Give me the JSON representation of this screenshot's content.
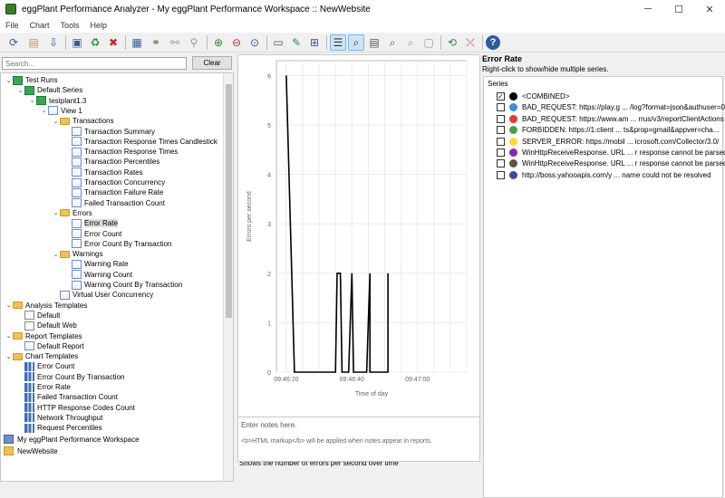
{
  "window": {
    "title": "eggPlant Performance Analyzer - My eggPlant Performance Workspace :: NewWebsite"
  },
  "menu": [
    "File",
    "Chart",
    "Tools",
    "Help"
  ],
  "search": {
    "placeholder": "Search...",
    "clear_label": "Clear"
  },
  "tree": [
    {
      "label": "Test Runs",
      "level": 0,
      "icon": "test-runs-icon",
      "exp": "v"
    },
    {
      "label": "Default Series",
      "level": 1,
      "icon": "series-icon",
      "exp": "v"
    },
    {
      "label": "testplant1.3",
      "level": 2,
      "icon": "run-icon",
      "exp": "v"
    },
    {
      "label": "View 1",
      "level": 3,
      "icon": "view-icon",
      "exp": "v"
    },
    {
      "label": "Transactions",
      "level": 4,
      "icon": "folder-icon",
      "exp": "v"
    },
    {
      "label": "Transaction Summary",
      "level": 5,
      "icon": "chart-icon",
      "exp": ""
    },
    {
      "label": "Transaction Response Times Candlestick",
      "level": 5,
      "icon": "chart-icon",
      "exp": ""
    },
    {
      "label": "Transaction Response Times",
      "level": 5,
      "icon": "chart-icon",
      "exp": ""
    },
    {
      "label": "Transaction Percentiles",
      "level": 5,
      "icon": "chart-icon",
      "exp": ""
    },
    {
      "label": "Transaction Rates",
      "level": 5,
      "icon": "chart-icon",
      "exp": ""
    },
    {
      "label": "Transaction Concurrency",
      "level": 5,
      "icon": "chart-icon",
      "exp": ""
    },
    {
      "label": "Transaction Failure Rate",
      "level": 5,
      "icon": "chart-icon",
      "exp": ""
    },
    {
      "label": "Failed Transaction Count",
      "level": 5,
      "icon": "chart-icon",
      "exp": ""
    },
    {
      "label": "Errors",
      "level": 4,
      "icon": "folder-icon",
      "exp": "v"
    },
    {
      "label": "Error Rate",
      "level": 5,
      "icon": "chart-icon",
      "exp": "",
      "selected": true
    },
    {
      "label": "Error Count",
      "level": 5,
      "icon": "chart-icon",
      "exp": ""
    },
    {
      "label": "Error Count By Transaction",
      "level": 5,
      "icon": "chart-icon",
      "exp": ""
    },
    {
      "label": "Warnings",
      "level": 4,
      "icon": "folder-icon",
      "exp": "v"
    },
    {
      "label": "Warning Rate",
      "level": 5,
      "icon": "chart-icon",
      "exp": ""
    },
    {
      "label": "Warning Count",
      "level": 5,
      "icon": "chart-icon",
      "exp": ""
    },
    {
      "label": "Warning Count By Transaction",
      "level": 5,
      "icon": "chart-icon",
      "exp": ""
    },
    {
      "label": "Virtual User Concurrency",
      "level": 4,
      "icon": "chart-icon",
      "exp": ""
    },
    {
      "label": "Analysis Templates",
      "level": 0,
      "icon": "templates-icon",
      "exp": "v"
    },
    {
      "label": "Default",
      "level": 1,
      "icon": "template-icon",
      "exp": ""
    },
    {
      "label": "Default Web",
      "level": 1,
      "icon": "template-icon",
      "exp": ""
    },
    {
      "label": "Report Templates",
      "level": 0,
      "icon": "templates-icon",
      "exp": "v"
    },
    {
      "label": "Default Report",
      "level": 1,
      "icon": "report-icon",
      "exp": ""
    },
    {
      "label": "Chart Templates",
      "level": 0,
      "icon": "templates-icon",
      "exp": "v"
    },
    {
      "label": "Error Count",
      "level": 1,
      "icon": "bar-chart-icon",
      "exp": ""
    },
    {
      "label": "Error Count By Transaction",
      "level": 1,
      "icon": "bar-chart-icon",
      "exp": ""
    },
    {
      "label": "Error Rate",
      "level": 1,
      "icon": "bar-chart-icon",
      "exp": ""
    },
    {
      "label": "Failed Transaction Count",
      "level": 1,
      "icon": "bar-chart-icon",
      "exp": ""
    },
    {
      "label": "HTTP Response Codes Count",
      "level": 1,
      "icon": "bar-chart-icon",
      "exp": ""
    },
    {
      "label": "Network Throughput",
      "level": 1,
      "icon": "bar-chart-icon",
      "exp": ""
    },
    {
      "label": "Request Percentiles",
      "level": 1,
      "icon": "bar-chart-icon",
      "exp": ""
    }
  ],
  "workspace": {
    "name": "My eggPlant Performance Workspace",
    "project": "NewWebsite"
  },
  "chart_data": {
    "type": "line",
    "ylabel": "Errors per second",
    "xlabel": "Time of day",
    "ylim": [
      0,
      6.3
    ],
    "yticks": [
      "0",
      "1",
      "2",
      "3",
      "4",
      "5",
      "6"
    ],
    "xticks": [
      {
        "t": 0,
        "label": "09:46:20"
      },
      {
        "t": 20,
        "label": "09:46:40"
      },
      {
        "t": 40,
        "label": "09:47:00"
      }
    ],
    "xlim": [
      -3,
      55
    ],
    "grid": true,
    "series": [
      {
        "color": "#000000",
        "points": [
          [
            0,
            6
          ],
          [
            2.5,
            0
          ],
          [
            15,
            0
          ],
          [
            15.5,
            2
          ],
          [
            16.5,
            2
          ],
          [
            17,
            0
          ],
          [
            19,
            0
          ],
          [
            20,
            2
          ],
          [
            20.5,
            0
          ],
          [
            24.5,
            0
          ],
          [
            25.5,
            2
          ],
          [
            25.5,
            0
          ],
          [
            31,
            0
          ],
          [
            31,
            2
          ]
        ]
      }
    ],
    "description": "Shows the number of errors per second over time"
  },
  "notes": {
    "placeholder": "Enter notes here.",
    "hint": "<b>HTML markup</b> will be applied when notes appear in reports."
  },
  "panel": {
    "title": "Error Rate",
    "subtitle": "Right-click to show/hide multiple series.",
    "series_header": "Series",
    "series": [
      {
        "checked": true,
        "color": "#000000",
        "label": "<COMBINED>"
      },
      {
        "checked": false,
        "color": "#3b8ee8",
        "label": "BAD_REQUEST: https://play.g ... /log?format=json&authuser=0"
      },
      {
        "checked": false,
        "color": "#e53935",
        "label": "BAD_REQUEST: https://www.am ... rrus/v3/reportClientActions"
      },
      {
        "checked": false,
        "color": "#43a047",
        "label": "FORBIDDEN: https://1.client ... ts&prop=gmail&appver=cha..."
      },
      {
        "checked": false,
        "color": "#fdd835",
        "label": "SERVER_ERROR: https://mobil ... icrosoft.com/Collector/3.0/"
      },
      {
        "checked": false,
        "color": "#8e24aa",
        "label": "WinHttpReceiveResponse. URL ... r response cannot be parsed"
      },
      {
        "checked": false,
        "color": "#6d4c41",
        "label": "WinHttpReceiveResponse. URL ... r response cannot be parsed"
      },
      {
        "checked": false,
        "color": "#3949ab",
        "label": "http://boss.yahooapis.com/y ...  name could not be resolved"
      }
    ]
  }
}
